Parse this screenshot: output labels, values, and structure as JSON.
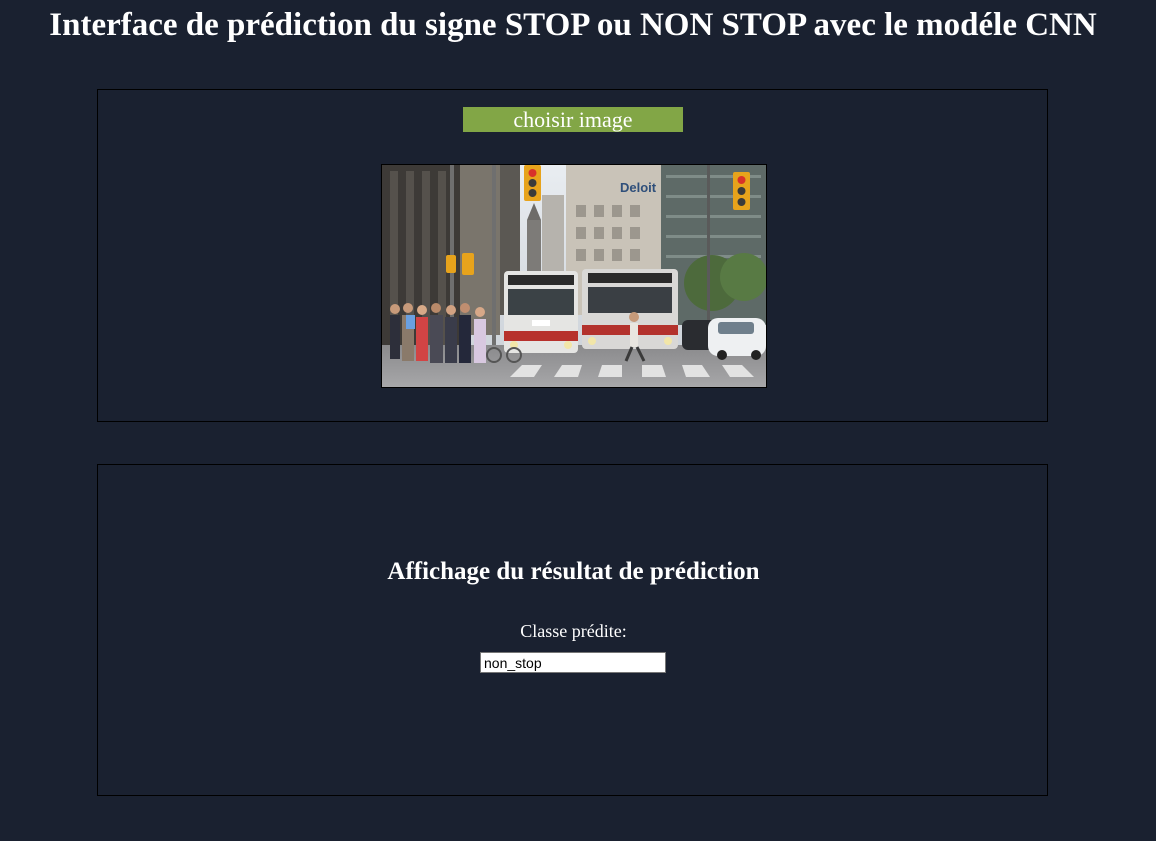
{
  "page": {
    "title": "Interface de prédiction du signe STOP ou NON STOP avec le modéle CNN",
    "background_color": "#1a2130"
  },
  "upload": {
    "button_label": "choisir image",
    "button_color": "#82a646",
    "preview_image": {
      "icon": "street-scene-photo",
      "building_sign_text": "Deloit"
    }
  },
  "result": {
    "heading": "Affichage du résultat de prédiction",
    "class_label": "Classe prédite:",
    "predicted_class": "non_stop"
  }
}
